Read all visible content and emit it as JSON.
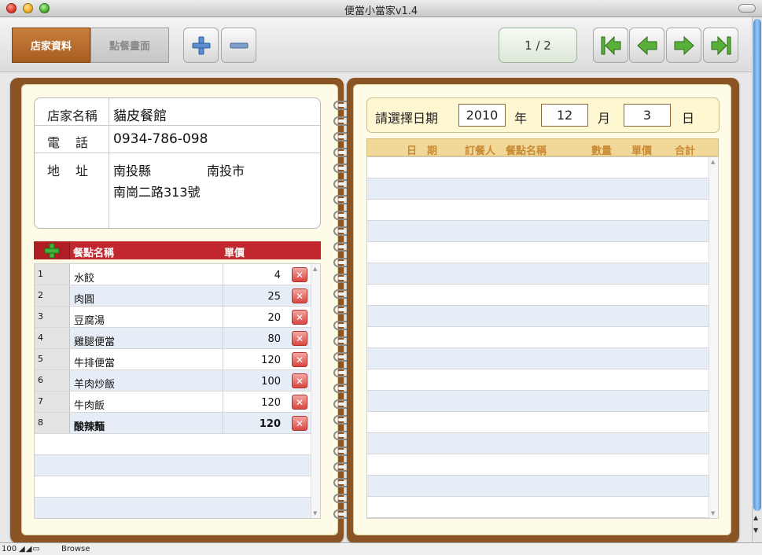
{
  "window": {
    "title": "便當小當家v1.4"
  },
  "toolbar": {
    "tab_store": "店家資料",
    "tab_order": "點餐畫面",
    "record_counter": "1 / 2"
  },
  "store": {
    "name_label": "店家名稱",
    "name_value": "貓皮餐館",
    "phone_label": "電　話",
    "phone_value": "0934-786-098",
    "address_label": "地　址",
    "address_county": "南投縣",
    "address_city": "南投市",
    "address_street": "南崗二路313號"
  },
  "menu": {
    "col_name": "餐點名稱",
    "col_price": "單價",
    "rows": [
      {
        "no": "1",
        "name": "水餃",
        "price": "4"
      },
      {
        "no": "2",
        "name": "肉圓",
        "price": "25"
      },
      {
        "no": "3",
        "name": "豆腐湯",
        "price": "20"
      },
      {
        "no": "4",
        "name": "雞腿便當",
        "price": "80"
      },
      {
        "no": "5",
        "name": "牛排便當",
        "price": "120"
      },
      {
        "no": "6",
        "name": "羊肉炒飯",
        "price": "100"
      },
      {
        "no": "7",
        "name": "牛肉飯",
        "price": "120"
      },
      {
        "no": "8",
        "name": "酸辣麵",
        "price": "120"
      }
    ]
  },
  "date": {
    "prompt": "請選擇日期",
    "year_value": "2010",
    "year_label": "年",
    "month_value": "12",
    "month_label": "月",
    "day_value": "3",
    "day_label": "日"
  },
  "orders": {
    "col_date": "日　期",
    "col_person": "訂餐人",
    "col_item": "餐點名稱",
    "col_qty": "數量",
    "col_price": "單價",
    "col_total": "合計"
  },
  "statusbar": {
    "zoom": "100",
    "mode": "Browse"
  },
  "colors": {
    "accent_brown": "#8b5424",
    "tab_active": "#b06826",
    "menu_header_red": "#c1272d",
    "orders_header": "#f1d898"
  }
}
